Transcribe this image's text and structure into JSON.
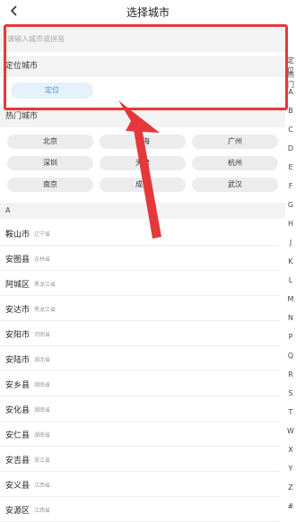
{
  "header": {
    "title": "选择城市",
    "back_icon": "chevron-left-icon"
  },
  "search": {
    "placeholder": "请输入城市或拼音"
  },
  "location": {
    "header": "定位城市",
    "button_label": "定位"
  },
  "hot": {
    "header": "热门城市",
    "cities": [
      "北京",
      "上海",
      "广州",
      "深圳",
      "天津",
      "杭州",
      "南京",
      "成都",
      "武汉"
    ]
  },
  "list": {
    "letter": "A",
    "cities": [
      {
        "name": "鞍山市",
        "province": "辽宁省"
      },
      {
        "name": "安图县",
        "province": "吉林省"
      },
      {
        "name": "阿城区",
        "province": "黑龙江省"
      },
      {
        "name": "安达市",
        "province": "黑龙江省"
      },
      {
        "name": "安阳市",
        "province": "河南省"
      },
      {
        "name": "安陆市",
        "province": "湖北省"
      },
      {
        "name": "安乡县",
        "province": "湖南省"
      },
      {
        "name": "安化县",
        "province": "湖南省"
      },
      {
        "name": "安仁县",
        "province": "湖南省"
      },
      {
        "name": "安吉县",
        "province": "浙江省"
      },
      {
        "name": "安义县",
        "province": "江西省"
      },
      {
        "name": "安源区",
        "province": "江西省"
      }
    ]
  },
  "index_bar": {
    "items": [
      "定位",
      "热门",
      "A",
      "B",
      "C",
      "D",
      "E",
      "F",
      "G",
      "H",
      "J",
      "K",
      "L",
      "M",
      "N",
      "P",
      "Q",
      "R",
      "S",
      "T",
      "W",
      "X",
      "Y",
      "Z",
      "#"
    ]
  },
  "annotation": {
    "color": "#e5383b"
  },
  "colors": {
    "accent": "#4a90d9",
    "section_bg": "#f3f3f3",
    "chip_bg": "#ececec"
  }
}
